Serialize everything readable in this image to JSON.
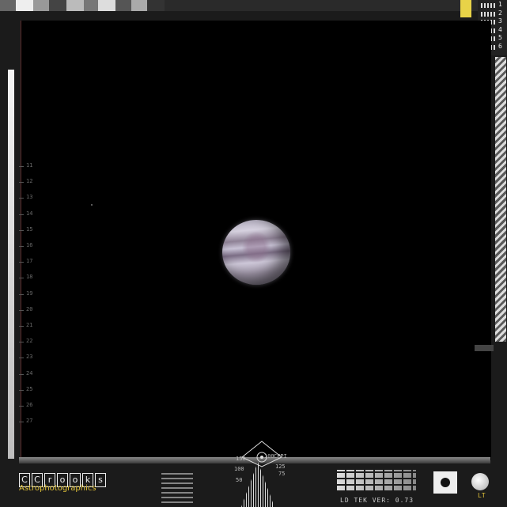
{
  "scale_ticks": [
    "11",
    "12",
    "13",
    "14",
    "15",
    "16",
    "17",
    "18",
    "19",
    "20",
    "21",
    "22",
    "23",
    "24",
    "25",
    "26",
    "27"
  ],
  "channels": [
    "1",
    "2",
    "3",
    "4",
    "5",
    "6"
  ],
  "logo": {
    "letters": [
      "C",
      "C",
      "r",
      "o",
      "o",
      "k",
      "s"
    ],
    "subtitle": "Astrophotographics"
  },
  "reticle_scale": {
    "left_top": "150",
    "left_mid": "100",
    "left_low": "50",
    "right_top": "CPPI",
    "right_mid": "125",
    "right_low": "75",
    "center": "100"
  },
  "version_text": "LD TEK VER: 0.73",
  "lt_label": "LT",
  "colors": {
    "accent_yellow": "#e8d348",
    "planet_tone": "#c9c3d6"
  }
}
